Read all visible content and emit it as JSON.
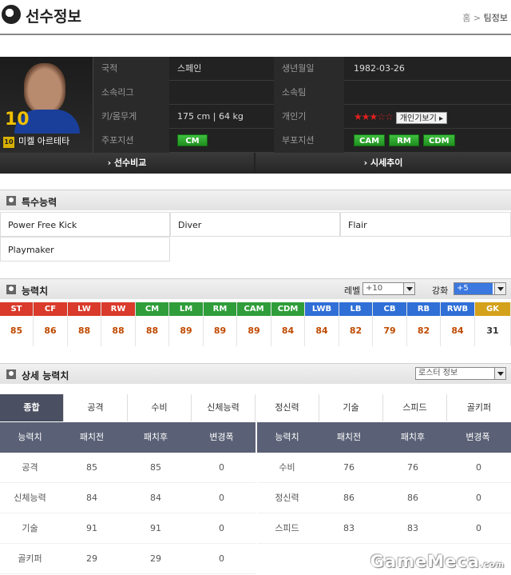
{
  "header": {
    "title": "선수정보",
    "breadcrumb_home": "홈",
    "breadcrumb_sep": ">",
    "breadcrumb_current": "팀정보"
  },
  "player": {
    "overall": "10",
    "grade_badge": "10",
    "name": "미켈 아르테타",
    "nationality_label": "국적",
    "nationality": "스페인",
    "birth_label": "생년월일",
    "birth": "1982-03-26",
    "league_label": "소속리그",
    "league": "",
    "team_label": "소속팀",
    "team": "",
    "body_label": "키/몸무게",
    "body": "175 cm  |  64 kg",
    "popularity_label": "개인기",
    "popularity_stars": 3,
    "popularity_max": 5,
    "skill_button": "개인기보기",
    "main_pos_label": "주포지션",
    "main_positions": [
      "CM"
    ],
    "sub_pos_label": "부포지션",
    "sub_positions": [
      "CAM",
      "RM",
      "CDM"
    ],
    "compare_button": "› 선수비교",
    "price_button": "› 시세추이",
    "colors": {
      "position_green": "#2aa52a",
      "star_red": "#e02020",
      "overall_gold": "#f0c000"
    }
  },
  "special": {
    "title": "특수능력",
    "items": [
      "Power Free Kick",
      "Diver",
      "Flair",
      "Playmaker"
    ]
  },
  "abilities": {
    "title": "능력치",
    "level_label": "레벨",
    "level_value": "+10",
    "enhance_label": "강화",
    "enhance_value": "+5",
    "positions": [
      {
        "pos": "ST",
        "val": "85",
        "color": "#d93a2b"
      },
      {
        "pos": "CF",
        "val": "86",
        "color": "#d93a2b"
      },
      {
        "pos": "LW",
        "val": "88",
        "color": "#d93a2b"
      },
      {
        "pos": "RW",
        "val": "88",
        "color": "#d93a2b"
      },
      {
        "pos": "CM",
        "val": "88",
        "color": "#2f9e3a"
      },
      {
        "pos": "LM",
        "val": "89",
        "color": "#2f9e3a"
      },
      {
        "pos": "RM",
        "val": "89",
        "color": "#2f9e3a"
      },
      {
        "pos": "CAM",
        "val": "89",
        "color": "#2f9e3a"
      },
      {
        "pos": "CDM",
        "val": "84",
        "color": "#2f9e3a"
      },
      {
        "pos": "LWB",
        "val": "84",
        "color": "#2f6fd6"
      },
      {
        "pos": "LB",
        "val": "82",
        "color": "#2f6fd6"
      },
      {
        "pos": "CB",
        "val": "79",
        "color": "#2f6fd6"
      },
      {
        "pos": "RB",
        "val": "82",
        "color": "#2f6fd6"
      },
      {
        "pos": "RWB",
        "val": "84",
        "color": "#2f6fd6"
      },
      {
        "pos": "GK",
        "val": "31",
        "color": "#d4a11a"
      }
    ]
  },
  "detail": {
    "title": "상세 능력치",
    "roster_select": "로스터 정보",
    "tabs": [
      "종합",
      "공격",
      "수비",
      "신체능력",
      "정신력",
      "기술",
      "스피드",
      "골키퍼"
    ],
    "columns": [
      "능력치",
      "패치전",
      "패치후",
      "변경폭"
    ],
    "left_rows": [
      [
        "공격",
        "85",
        "85",
        "0"
      ],
      [
        "신체능력",
        "84",
        "84",
        "0"
      ],
      [
        "기술",
        "91",
        "91",
        "0"
      ],
      [
        "골키퍼",
        "29",
        "29",
        "0"
      ]
    ],
    "right_rows": [
      [
        "수비",
        "76",
        "76",
        "0"
      ],
      [
        "정신력",
        "86",
        "86",
        "0"
      ],
      [
        "스피드",
        "83",
        "83",
        "0"
      ]
    ]
  },
  "watermark": {
    "text": "GameMeca",
    "suffix": ".com"
  }
}
